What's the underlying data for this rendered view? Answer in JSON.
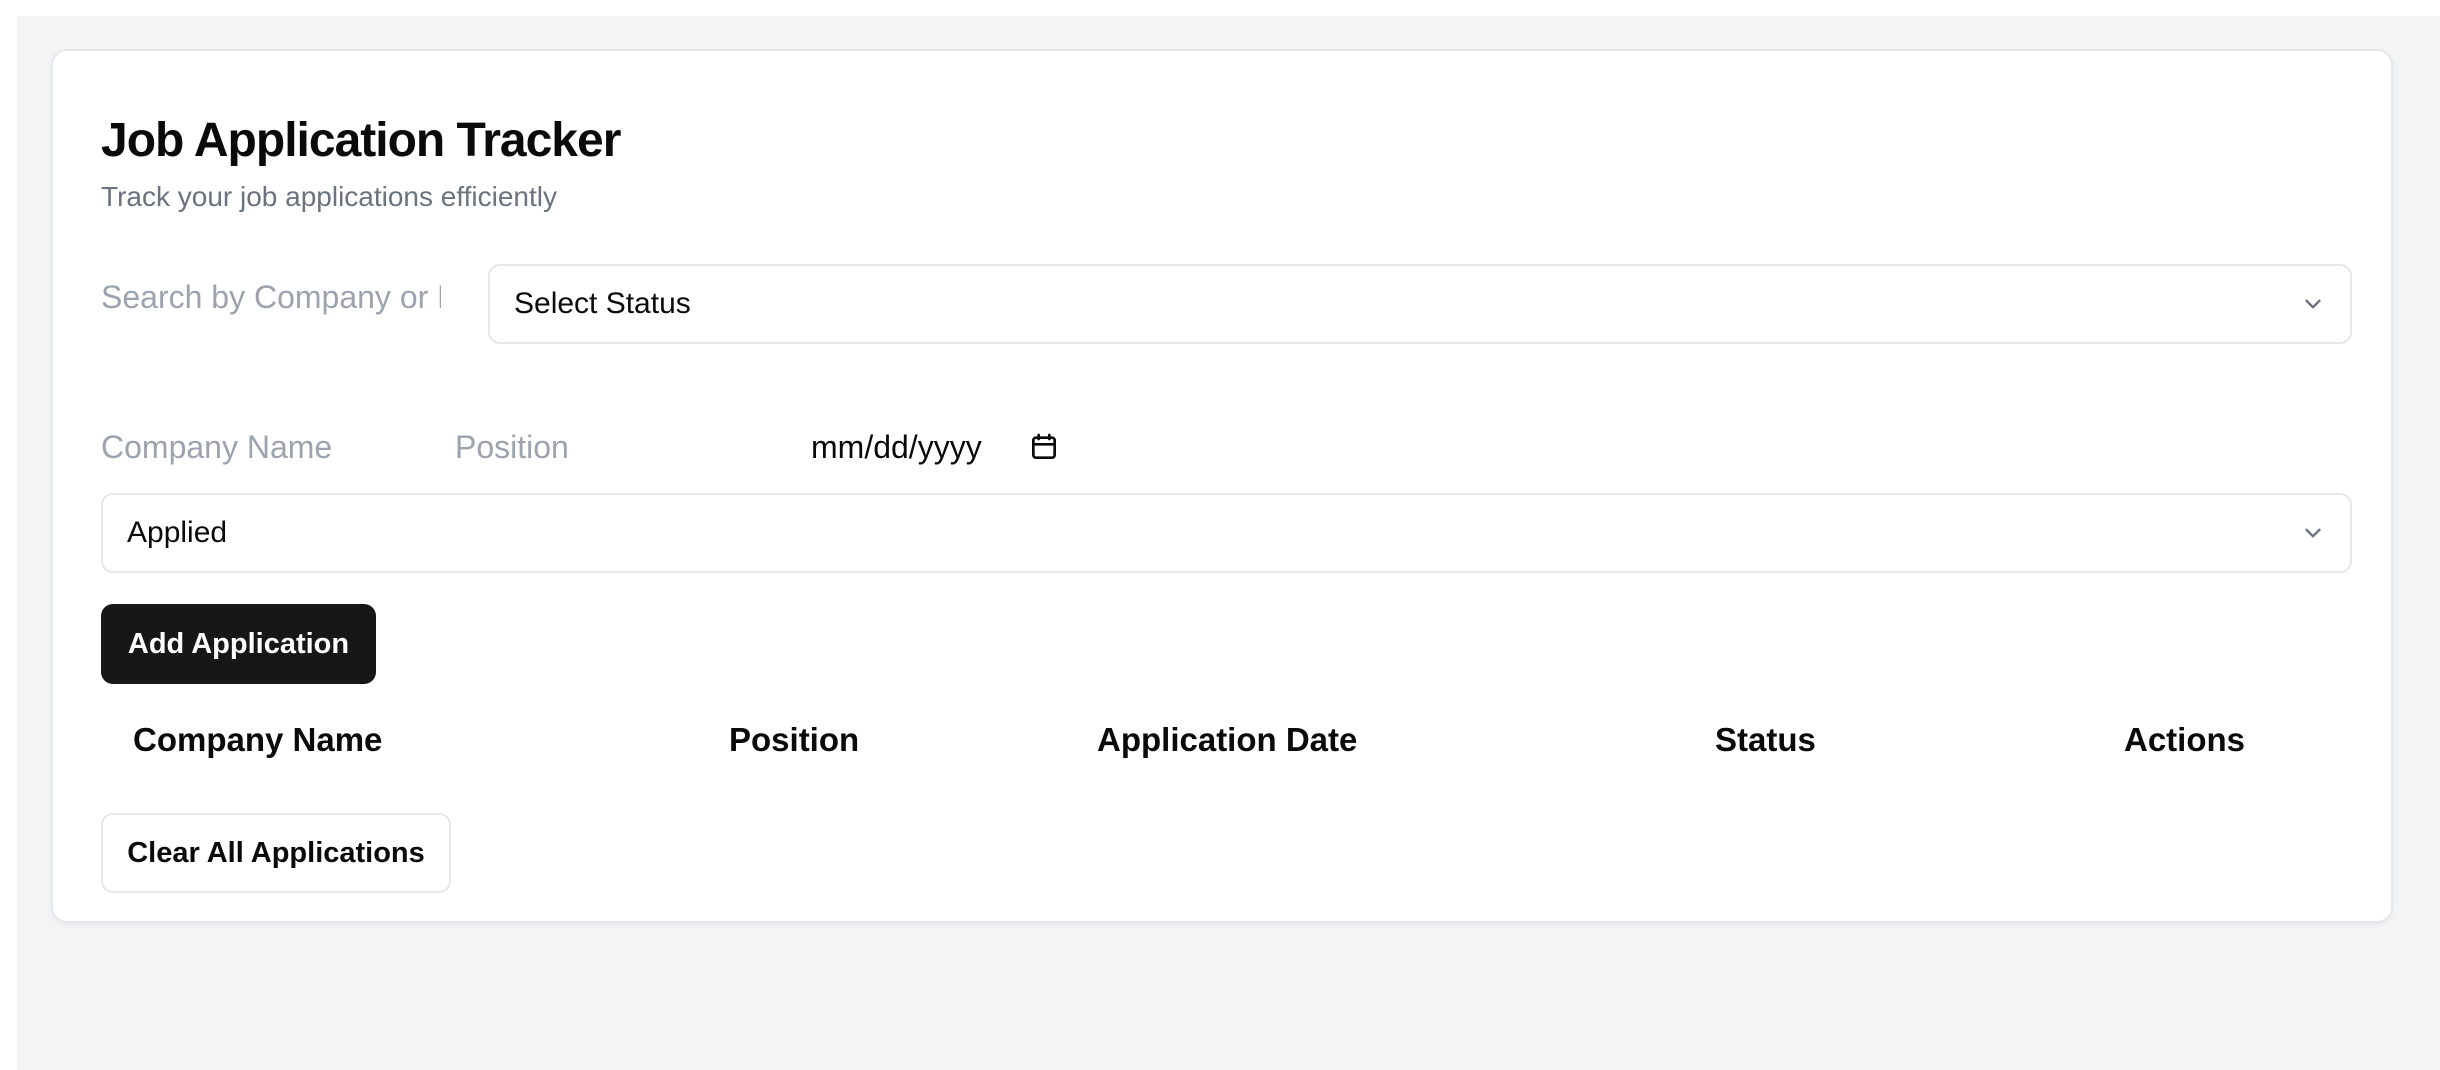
{
  "app": {
    "title": "Job Application Tracker",
    "subtitle": "Track your job applications efficiently"
  },
  "filters": {
    "search_placeholder": "Search by Company or Position",
    "status_filter_value": "Select Status"
  },
  "form": {
    "company_placeholder": "Company Name",
    "position_placeholder": "Position",
    "date_placeholder": "mm/dd/yyyy",
    "status_value": "Applied",
    "add_label": "Add Application"
  },
  "table": {
    "headers": [
      "Company Name",
      "Position",
      "Application Date",
      "Status",
      "Actions"
    ],
    "rows": []
  },
  "actions": {
    "clear_label": "Clear All Applications"
  },
  "colors": {
    "background": "#f3f4f6",
    "card": "#ffffff",
    "primary_button": "#171717",
    "muted_text": "#6b7280",
    "placeholder": "#9ca3af",
    "border": "#e5e7eb"
  },
  "icons": {
    "select_chevron": "chevron-down-icon",
    "date_picker": "calendar-icon"
  }
}
